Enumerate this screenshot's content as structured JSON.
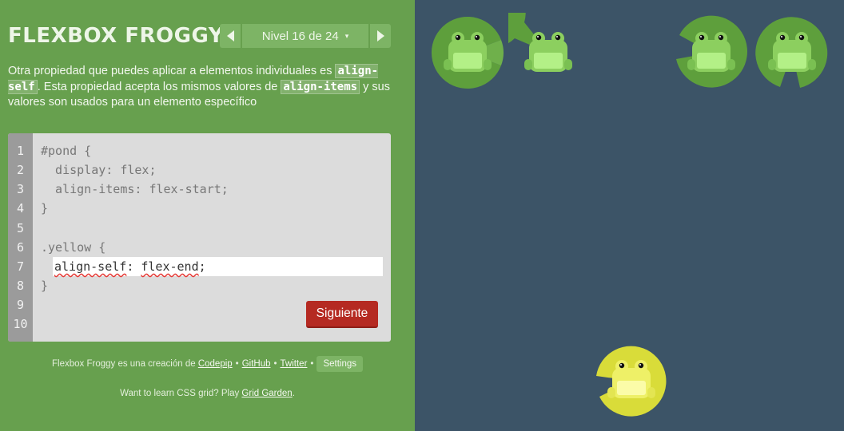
{
  "header": {
    "title": "FLEXBOX FROGGY",
    "level_label": "Nivel 16 de 24",
    "caret": "▾"
  },
  "instructions": {
    "t1": "Otra propiedad que puedes aplicar a elementos individuales es ",
    "c1": "align-self",
    "t2": ". Esta propiedad acepta los mismos valores de ",
    "c2": "align-items",
    "t3": " y sus valores son usados para un elemento específico"
  },
  "editor": {
    "line_numbers": [
      "1",
      "2",
      "3",
      "4",
      "5",
      "6",
      "7",
      "8",
      "9",
      "10"
    ],
    "lines": [
      "#pond {",
      "  display: flex;",
      "  align-items: flex-start;",
      "}",
      "",
      ".yellow {",
      "",
      "}",
      "",
      ""
    ],
    "input_property": "align-self",
    "input_sep": ": ",
    "input_value": "flex-end",
    "input_end": ";",
    "next_label": "Siguiente"
  },
  "footer": {
    "credit_text": "Flexbox Froggy es una creación de ",
    "codepip": "Codepip",
    "github": "GitHub",
    "twitter": "Twitter",
    "bullet": "•",
    "settings_label": "Settings",
    "grid_text": "Want to learn CSS grid? Play ",
    "grid_link": "Grid Garden",
    "grid_end": "."
  },
  "pond": {
    "frogs": [
      {
        "name": "green-frog-1",
        "color": "green"
      },
      {
        "name": "green-frog-2",
        "color": "green"
      },
      {
        "name": "green-frog-3",
        "color": "green"
      },
      {
        "name": "green-frog-4",
        "color": "green"
      },
      {
        "name": "yellow-frog",
        "color": "yellow"
      }
    ]
  },
  "colors": {
    "sidebar_bg": "#67a04e",
    "pond_bg": "#3c5467",
    "green_pad": "#5e9f3c",
    "yellow_pad": "#d9dc39",
    "button_red": "#b52a22"
  }
}
